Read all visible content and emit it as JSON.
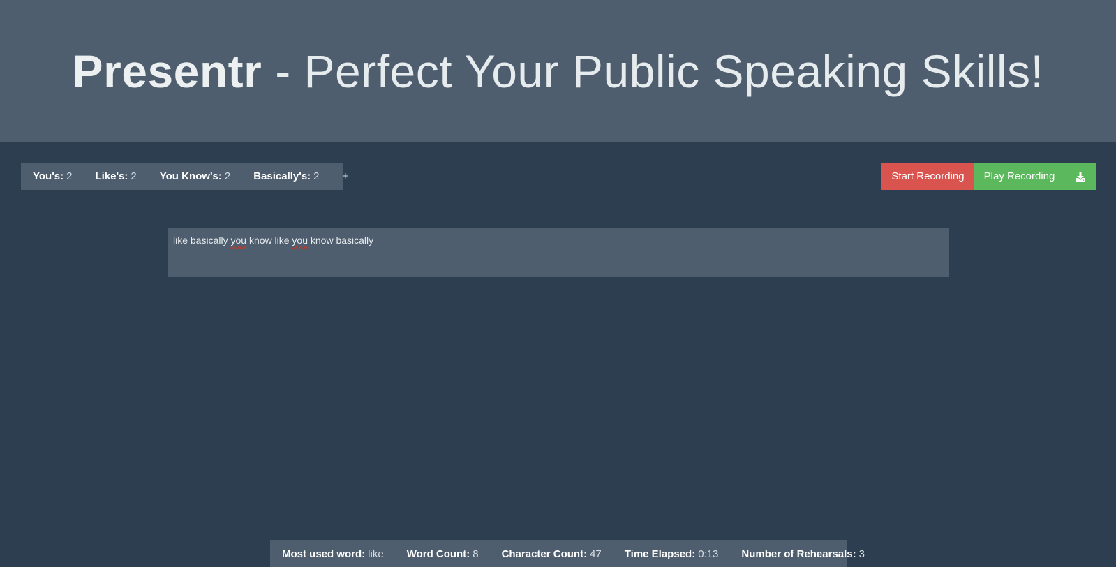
{
  "header": {
    "brand": "Presentr",
    "tagline": " - Perfect Your Public Speaking Skills!"
  },
  "counters": {
    "items": [
      {
        "label": "You's:",
        "value": "2"
      },
      {
        "label": "Like's:",
        "value": "2"
      },
      {
        "label": "You Know's:",
        "value": "2"
      },
      {
        "label": "Basically's:",
        "value": "2"
      }
    ],
    "add_label": "+"
  },
  "actions": {
    "start_label": "Start Recording",
    "play_label": "Play Recording",
    "download_icon": "download-icon"
  },
  "editor": {
    "words": [
      "like basically ",
      "you",
      " know like ",
      "you",
      " know basically"
    ]
  },
  "stats": {
    "items": [
      {
        "label": "Most used word:",
        "value": "like"
      },
      {
        "label": "Word Count:",
        "value": "8"
      },
      {
        "label": "Character Count:",
        "value": "47"
      },
      {
        "label": "Time Elapsed:",
        "value": "0:13"
      },
      {
        "label": "Number of Rehearsals:",
        "value": "3"
      }
    ]
  },
  "colors": {
    "background": "#2c3e50",
    "panel": "#4e5e6e",
    "danger": "#d9534f",
    "success": "#5cb85c"
  }
}
